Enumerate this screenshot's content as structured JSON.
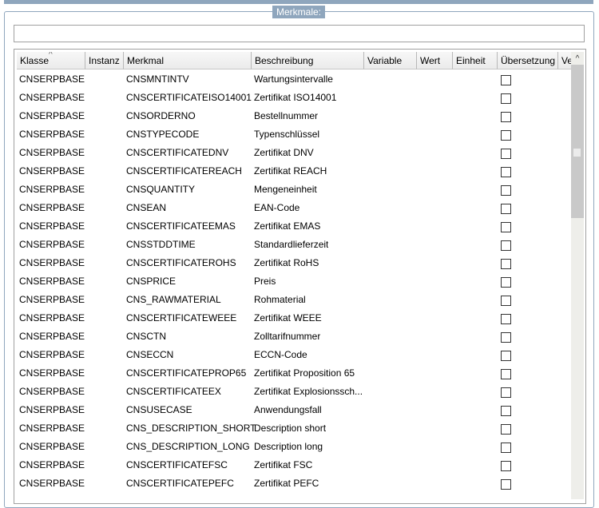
{
  "group_title": "Merkmale:",
  "filter_value": "",
  "columns": [
    "Klasse",
    "Instanz",
    "Merkmal",
    "Beschreibung",
    "Variable",
    "Wert",
    "Einheit",
    "Übersetzung",
    "Ve"
  ],
  "rows": [
    [
      "CNSERPBASE",
      "",
      "CNSMNTINTV",
      "Wartungsintervalle"
    ],
    [
      "CNSERPBASE",
      "",
      "CNSCERTIFICATEISO14001",
      "Zertifikat ISO14001"
    ],
    [
      "CNSERPBASE",
      "",
      "CNSORDERNO",
      "Bestellnummer"
    ],
    [
      "CNSERPBASE",
      "",
      "CNSTYPECODE",
      "Typenschlüssel"
    ],
    [
      "CNSERPBASE",
      "",
      "CNSCERTIFICATEDNV",
      "Zertifikat DNV"
    ],
    [
      "CNSERPBASE",
      "",
      "CNSCERTIFICATEREACH",
      "Zertifikat REACH"
    ],
    [
      "CNSERPBASE",
      "",
      "CNSQUANTITY",
      "Mengeneinheit"
    ],
    [
      "CNSERPBASE",
      "",
      "CNSEAN",
      "EAN-Code"
    ],
    [
      "CNSERPBASE",
      "",
      "CNSCERTIFICATEEMAS",
      "Zertifikat EMAS"
    ],
    [
      "CNSERPBASE",
      "",
      "CNSSTDDTIME",
      "Standardlieferzeit"
    ],
    [
      "CNSERPBASE",
      "",
      "CNSCERTIFICATEROHS",
      "Zertifikat RoHS"
    ],
    [
      "CNSERPBASE",
      "",
      "CNSPRICE",
      "Preis"
    ],
    [
      "CNSERPBASE",
      "",
      "CNS_RAWMATERIAL",
      "Rohmaterial"
    ],
    [
      "CNSERPBASE",
      "",
      "CNSCERTIFICATEWEEE",
      "Zertifikat WEEE"
    ],
    [
      "CNSERPBASE",
      "",
      "CNSCTN",
      "Zolltarifnummer"
    ],
    [
      "CNSERPBASE",
      "",
      "CNSECCN",
      "ECCN-Code"
    ],
    [
      "CNSERPBASE",
      "",
      "CNSCERTIFICATEPROP65",
      "Zertifikat Proposition 65"
    ],
    [
      "CNSERPBASE",
      "",
      "CNSCERTIFICATEEX",
      "Zertifikat Explosionssch..."
    ],
    [
      "CNSERPBASE",
      "",
      "CNSUSECASE",
      "Anwendungsfall"
    ],
    [
      "CNSERPBASE",
      "",
      "CNS_DESCRIPTION_SHORT",
      "Description short"
    ],
    [
      "CNSERPBASE",
      "",
      "CNS_DESCRIPTION_LONG",
      "Description long"
    ],
    [
      "CNSERPBASE",
      "",
      "CNSCERTIFICATEFSC",
      "Zertifikat FSC"
    ],
    [
      "CNSERPBASE",
      "",
      "CNSCERTIFICATEPEFC",
      "Zertifikat PEFC"
    ]
  ],
  "translation_checked": [
    false,
    false,
    false,
    false,
    false,
    false,
    false,
    false,
    false,
    false,
    false,
    false,
    false,
    false,
    false,
    false,
    false,
    false,
    false,
    false,
    false,
    false,
    false
  ]
}
